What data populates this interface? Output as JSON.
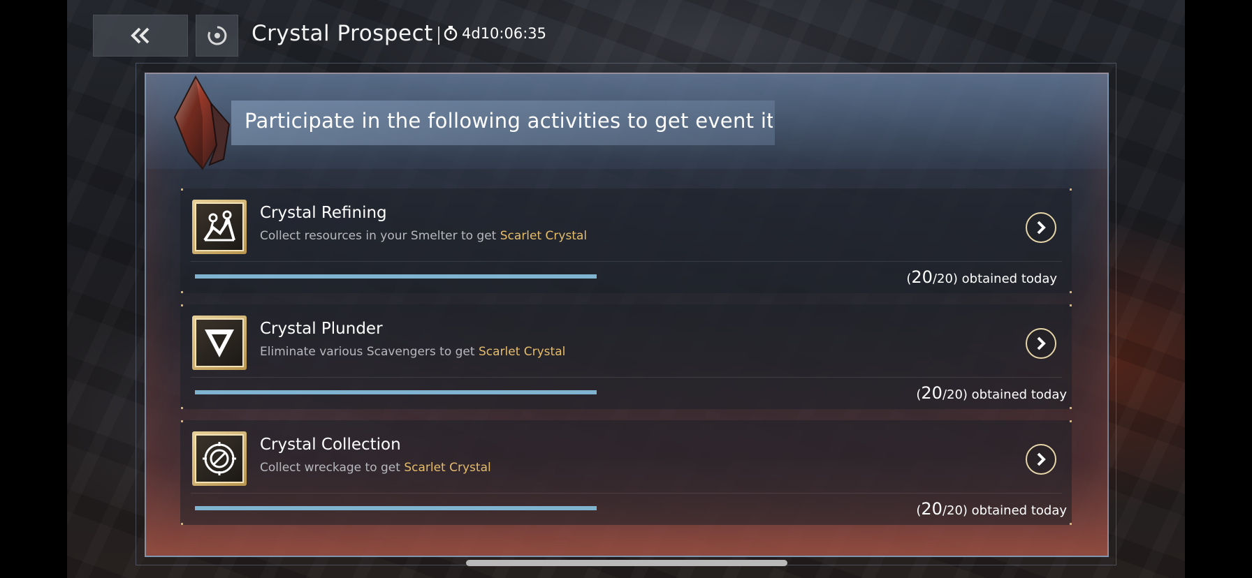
{
  "header": {
    "title": "Crystal Prospect",
    "timer": "4d10:06:35"
  },
  "banner": {
    "text": "Participate in the following activities to get event ite"
  },
  "activities": [
    {
      "title": "Crystal Refining",
      "desc_prefix": "Collect resources in your Smelter to get ",
      "desc_highlight": "Scarlet Crystal",
      "count_open": "(",
      "count_current": "20",
      "count_total": "/20)",
      "count_suffix": " obtained today",
      "progress": 1.0,
      "icon": "refining-icon"
    },
    {
      "title": "Crystal Plunder",
      "desc_prefix": "Eliminate various Scavengers to get ",
      "desc_highlight": "Scarlet Crystal",
      "count_open": "(",
      "count_current": "20",
      "count_total": "/20)",
      "count_suffix": " obtained today",
      "progress": 1.0,
      "icon": "plunder-icon"
    },
    {
      "title": "Crystal Collection",
      "desc_prefix": "Collect wreckage to get ",
      "desc_highlight": "Scarlet Crystal",
      "count_open": "(",
      "count_current": "20",
      "count_total": "/20)",
      "count_suffix": " obtained today",
      "progress": 1.0,
      "icon": "collection-icon"
    }
  ],
  "colors": {
    "highlight": "#e6bd6a",
    "progress": "#7fb3d0",
    "gold": "#e7d19a"
  }
}
